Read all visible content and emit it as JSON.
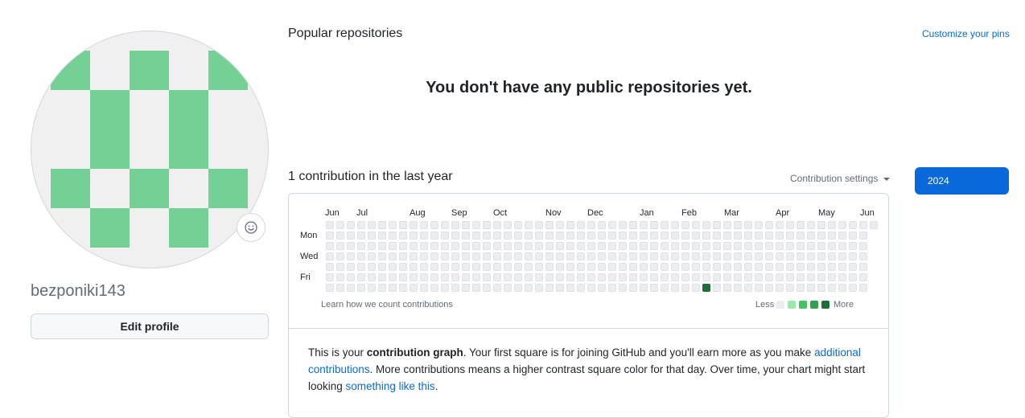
{
  "profile": {
    "username": "bezponiki143",
    "edit_label": "Edit profile",
    "avatar_color": "#75d096"
  },
  "popular": {
    "title": "Popular repositories",
    "customize": "Customize your pins",
    "empty": "You don't have any public repositories yet."
  },
  "contributions": {
    "title": "1 contribution in the last year",
    "settings": "Contribution settings",
    "year": "2024",
    "months": [
      "Jun",
      "Jul",
      "Aug",
      "Sep",
      "Oct",
      "Nov",
      "Dec",
      "Jan",
      "Feb",
      "Mar",
      "Apr",
      "May",
      "Jun"
    ],
    "days": [
      "Mon",
      "Wed",
      "Fri"
    ],
    "learn": "Learn how we count contributions",
    "less": "Less",
    "more": "More",
    "legend_colors": [
      "#ebedf0",
      "#9be9a8",
      "#40c463",
      "#30a14e",
      "#216e39"
    ],
    "weeks": 53,
    "active": {
      "week": 36,
      "day": 6,
      "color": "#216e39"
    }
  },
  "explanation": {
    "p1": "This is your ",
    "bold": "contribution graph",
    "p2": ". Your first square is for joining GitHub and you'll earn more as you make ",
    "link1": "additional contributions",
    "p3": ". More contributions means a higher contrast square color for that day. Over time, your chart might start looking ",
    "link2": "something like this",
    "p4": "."
  }
}
